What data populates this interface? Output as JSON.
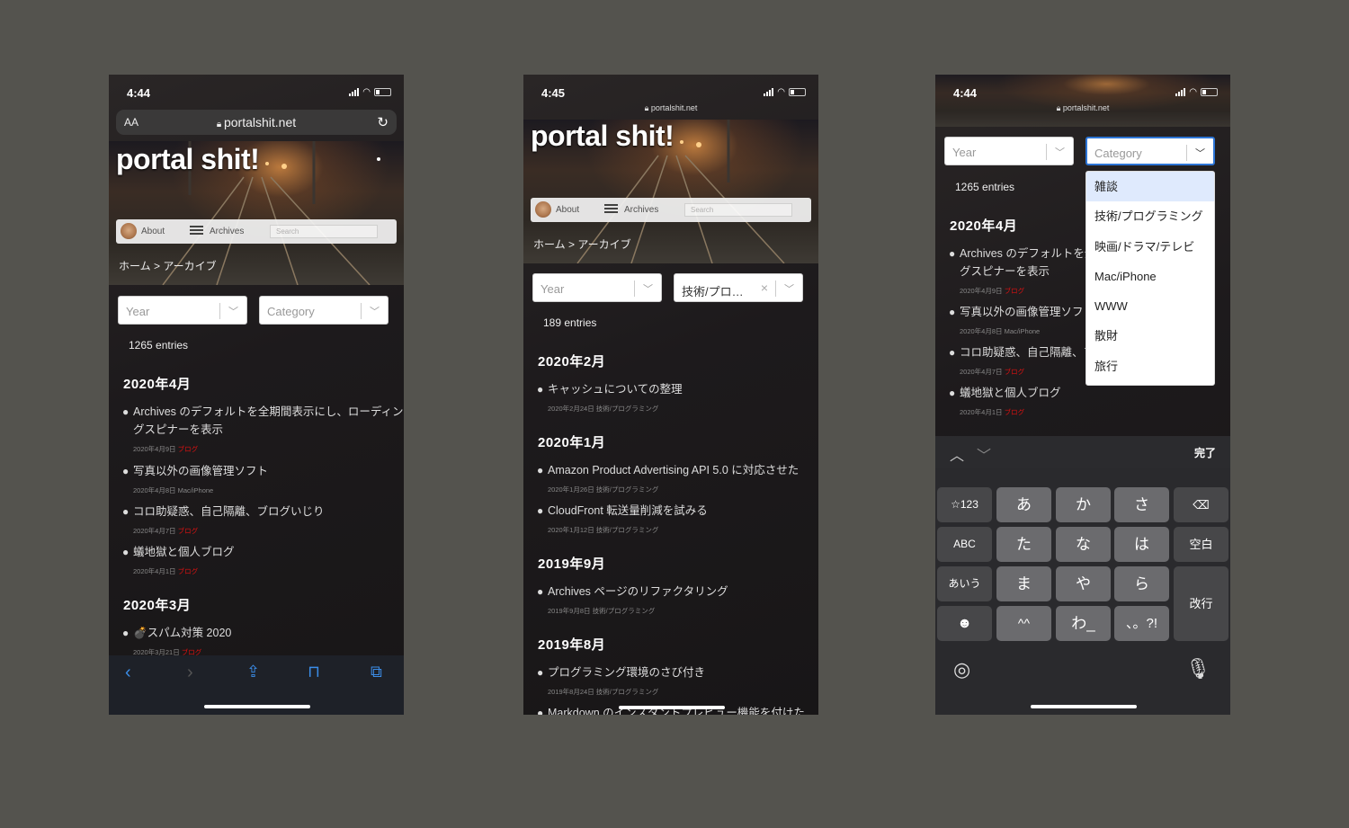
{
  "phone1": {
    "time": "4:44",
    "url_aa": "AA",
    "url": "portalshit.net",
    "site_title": "portal shit!",
    "nav": {
      "about": "About",
      "archives": "Archives",
      "search_placeholder": "Search"
    },
    "breadcrumb": "ホーム > アーカイブ",
    "year_select": "Year",
    "category_select": "Category",
    "entries": "1265 entries",
    "month1": "2020年4月",
    "posts": [
      {
        "title_line1": "Archives のデフォルトを全期間表示にし、ローディン",
        "title_line2": "グスピナーを表示",
        "date": "2020年4月9日",
        "category": "ブログ"
      },
      {
        "title": "写真以外の画像管理ソフト",
        "date": "2020年4月8日",
        "category": "Mac/iPhone"
      },
      {
        "title": "コロ助疑惑、自己隔離、ブログいじり",
        "date": "2020年4月7日",
        "category": "ブログ"
      },
      {
        "title": "蟻地獄と個人ブログ",
        "date": "2020年4月1日",
        "category": "ブログ"
      }
    ],
    "month2": "2020年3月",
    "post5": {
      "title": "💣スパム対策 2020",
      "date": "2020年3月21日",
      "category": "ブログ"
    }
  },
  "phone2": {
    "time": "4:45",
    "url": "portalshit.net",
    "site_title": "portal shit!",
    "nav": {
      "about": "About",
      "archives": "Archives",
      "search_placeholder": "Search"
    },
    "breadcrumb": "ホーム > アーカイブ",
    "year_select": "Year",
    "category_select": "技術/プロ…",
    "entries": "189 entries",
    "groups": [
      {
        "month": "2020年2月",
        "posts": [
          {
            "title": "キャッシュについての整理",
            "date": "2020年2月24日",
            "category": "技術/プログラミング"
          }
        ]
      },
      {
        "month": "2020年1月",
        "posts": [
          {
            "title": "Amazon Product Advertising API 5.0 に対応させた",
            "date": "2020年1月26日",
            "category": "技術/プログラミング"
          },
          {
            "title": "CloudFront 転送量削減を試みる",
            "date": "2020年1月12日",
            "category": "技術/プログラミング"
          }
        ]
      },
      {
        "month": "2019年9月",
        "posts": [
          {
            "title": "Archives ページのリファクタリング",
            "date": "2019年9月8日",
            "category": "技術/プログラミング"
          }
        ]
      },
      {
        "month": "2019年8月",
        "posts": [
          {
            "title": "プログラミング環境のさび付き",
            "date": "2019年8月24日",
            "category": "技術/プログラミング"
          },
          {
            "title": "Markdown のインスタントプレビュー機能を付けた",
            "date": "",
            "category": ""
          }
        ]
      }
    ]
  },
  "phone3": {
    "time": "4:44",
    "url": "portalshit.net",
    "year_select": "Year",
    "category_select": "Category",
    "entries": "1265 entries",
    "month1": "2020年4月",
    "posts": [
      {
        "title_line1": "Archives のデフォルトを全",
        "title_line2": "グスピナーを表示",
        "date": "2020年4月9日",
        "category": "ブログ"
      },
      {
        "title": "写真以外の画像管理ソフト",
        "date": "2020年4月8日",
        "category": "Mac/iPhone"
      },
      {
        "title": "コロ助疑惑、自己隔離、フ",
        "date": "2020年4月7日",
        "category": "ブログ"
      },
      {
        "title": "蟻地獄と個人ブログ",
        "date": "2020年4月1日",
        "category": "ブログ"
      }
    ],
    "dropdown_options": [
      "雑談",
      "技術/プログラミング",
      "映画/ドラマ/テレビ",
      "Mac/iPhone",
      "WWW",
      "散財",
      "旅行"
    ],
    "keyboard": {
      "done": "完了",
      "keys": [
        "☆123",
        "あ",
        "か",
        "さ",
        "⌫",
        "ABC",
        "た",
        "な",
        "は",
        "空白",
        "あいう",
        "ま",
        "や",
        "ら",
        "改行",
        "☻",
        "^^",
        "わ_",
        "、。?!"
      ]
    }
  },
  "colors": {
    "accent": "#3b8de8",
    "focus": "#2d75d6",
    "category_red": "#dd1111",
    "background": "#54534e"
  }
}
